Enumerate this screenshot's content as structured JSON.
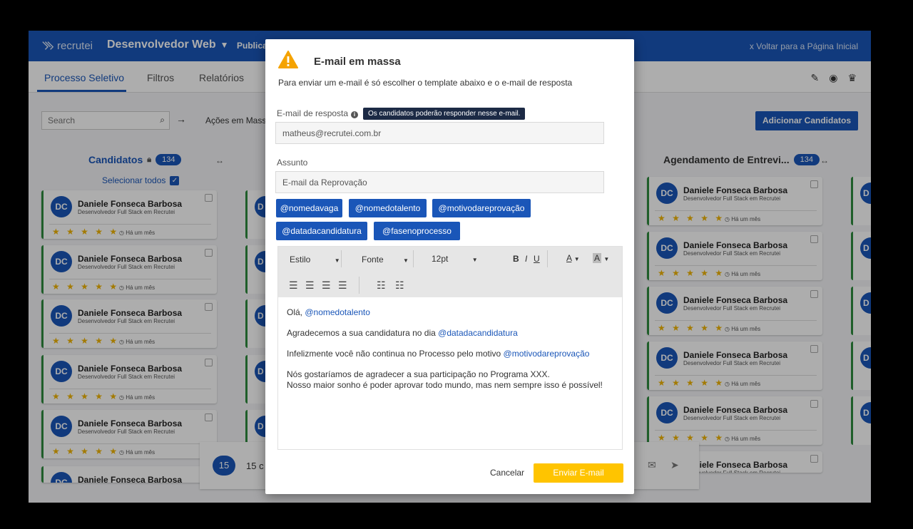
{
  "header": {
    "logo": "recrutei",
    "job_title": "Desenvolvedor Web",
    "published": "Publica",
    "back_link": "x Voltar para a Página Inicial"
  },
  "tabs": [
    "Processo Seletivo",
    "Filtros",
    "Relatórios"
  ],
  "toolbar": {
    "search_placeholder": "Search",
    "mass_actions": "Ações em Mass",
    "add_candidates": "Adicionar Candidatos"
  },
  "columns": {
    "candidatos": {
      "title": "Candidatos",
      "count": "134",
      "select_all": "Selecionar todos"
    },
    "agendamento": {
      "title": "Agendamento de Entrevi...",
      "count": "134"
    }
  },
  "card": {
    "initials": "DC",
    "name": "Daniele Fonseca Barbosa",
    "role": "Desenvolvedor Full Stack em Recrutei",
    "stars": "★ ★ ★ ★ ★",
    "time": "Há um mês"
  },
  "bottom_bar": {
    "count": "15",
    "text": "15 c"
  },
  "modal": {
    "title": "E-mail em massa",
    "subtitle": "Para enviar um e-mail é só escolher o template abaixo e o e-mail de resposta",
    "reply_label": "E-mail de resposta",
    "reply_tooltip": "Os candidatos poderão responder nesse e-mail.",
    "reply_value": "matheus@recrutei.com.br",
    "subject_label": "Assunto",
    "subject_value": "E-mail da Reprovação",
    "tags": [
      "@nomedavaga",
      "@nomedotalento",
      "@motivodareprovação",
      "@datadacandidatura",
      "@fasenoprocesso"
    ],
    "editor": {
      "style": "Estilo",
      "font": "Fonte",
      "size": "12pt",
      "bold": "B",
      "italic": "I",
      "underline": "U",
      "text_color": "A",
      "bg_color": "A",
      "greeting": "Olá, ",
      "greeting_var": "@nomedotalento",
      "line2": "Agradecemos a sua candidatura no dia ",
      "line2_var": "@datadacandidatura",
      "line3": "Infelizmente você não continua no Processo pelo motivo ",
      "line3_var": "@motivodareprovação",
      "line4": "Nós gostaríamos de agradecer a sua participação no Programa XXX.",
      "line5": "Nosso maior sonho é poder aprovar todo mundo, mas nem sempre isso é possível!"
    },
    "cancel": "Cancelar",
    "send": "Enviar E-mail"
  }
}
